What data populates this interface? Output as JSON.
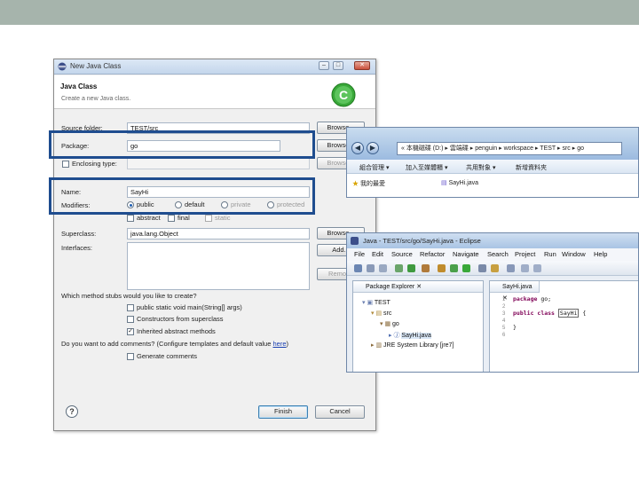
{
  "dialog": {
    "title": "New Java Class",
    "heading": "Java Class",
    "description": "Create a new Java class.",
    "source_folder": {
      "label": "Source folder:",
      "value": "TEST/src",
      "browse": "Browse..."
    },
    "package": {
      "label": "Package:",
      "value": "go",
      "browse": "Browse..."
    },
    "enclosing_type": {
      "label": "Enclosing type:",
      "value": "",
      "browse": "Browse..."
    },
    "name": {
      "label": "Name:",
      "value": "SayHi"
    },
    "modifiers": {
      "label": "Modifiers:",
      "options": [
        "public",
        "default",
        "private",
        "protected"
      ],
      "selected": "public",
      "abstract": "abstract",
      "final": "final",
      "static": "static"
    },
    "superclass": {
      "label": "Superclass:",
      "value": "java.lang.Object",
      "browse": "Browse..."
    },
    "interfaces": {
      "label": "Interfaces:",
      "add": "Add...",
      "remove": "Remove"
    },
    "stubs_question": "Which method stubs would you like to create?",
    "stubs": [
      {
        "label": "public static void main(String[] args)",
        "checked": false
      },
      {
        "label": "Constructors from superclass",
        "checked": false
      },
      {
        "label": "Inherited abstract methods",
        "checked": true
      }
    ],
    "comments_question_prefix": "Do you want to add comments? (Configure templates and default value ",
    "comments_link": "here",
    "comments_question_suffix": ")",
    "generate_comments": "Generate comments",
    "finish": "Finish",
    "cancel": "Cancel"
  },
  "explorer": {
    "address": "« 本機磁碟 (D:) ▸ 雲端碟 ▸ penguin ▸ workspace ▸ TEST ▸ src ▸ go",
    "toolbar": [
      "組合管理 ▾",
      "加入至媒體櫃 ▾",
      "共用對象 ▾",
      "新增資料夾"
    ],
    "favorites": "我的最愛",
    "file": "SayHi.java"
  },
  "eclipse": {
    "title": "Java - TEST/src/go/SayHi.java - Eclipse",
    "menu": [
      "File",
      "Edit",
      "Source",
      "Refactor",
      "Navigate",
      "Search",
      "Project",
      "Run",
      "Window",
      "Help"
    ],
    "package_explorer_tab": "Package Explorer ✕",
    "tree": {
      "project": "TEST",
      "src": "src",
      "package": "go",
      "file": "SayHi.java",
      "library": "JRE System Library [jre7]"
    },
    "editor_tab": "SayHi.java ✕",
    "line_numbers": [
      "1",
      "2",
      "3",
      "4",
      "5",
      "6"
    ],
    "code": {
      "kw_package": "package",
      "package_rest": " go;",
      "kw_public": "public",
      "kw_class": "class",
      "class_name": "SayHi",
      "open_brace": " {",
      "close_brace": "}"
    }
  },
  "colors": {
    "highlight_border": "#1f4d8f",
    "top_bar": "#a6b4ac"
  }
}
